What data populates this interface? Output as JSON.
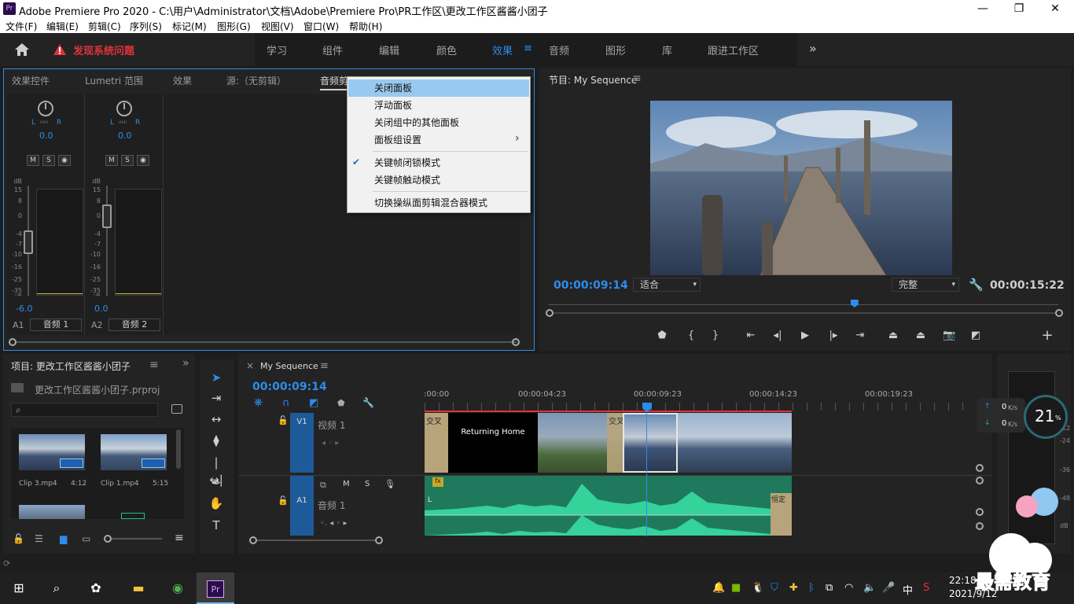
{
  "title_bar": {
    "app_icon": "Pr",
    "title": "Adobe Premiere Pro 2020 - C:\\用户\\Administrator\\文档\\Adobe\\Premiere Pro\\PR工作区\\更改工作区酱酱小团子",
    "minimize": "—",
    "maximize": "❐",
    "close": "✕"
  },
  "menu": [
    "文件(F)",
    "编辑(E)",
    "剪辑(C)",
    "序列(S)",
    "标记(M)",
    "图形(G)",
    "视图(V)",
    "窗口(W)",
    "帮助(H)"
  ],
  "workspace": {
    "home_icon": "home-icon",
    "alert_text": "发现系统问题",
    "tabs": [
      "学习",
      "组件",
      "编辑",
      "颜色",
      "效果",
      "音频",
      "图形",
      "库",
      "跟进工作区"
    ],
    "active": "效果",
    "more": "»"
  },
  "source_panel": {
    "tabs": [
      "效果控件",
      "Lumetri 范围",
      "效果",
      "源:（无剪辑）",
      "音频剪辑混合器"
    ],
    "active_tab": "音频剪辑混合器"
  },
  "mixer": {
    "channels": [
      {
        "id": "A1",
        "name": "音频 1",
        "pan": "0.0",
        "level": "-6.0",
        "L": "L",
        "R": "R"
      },
      {
        "id": "A2",
        "name": "音频 2",
        "pan": "0.0",
        "level": "0.0",
        "L": "L",
        "R": "R"
      }
    ],
    "btn_m": "M",
    "btn_s": "S",
    "btn_r": "◉",
    "db_scale": [
      "dB",
      "15",
      "8",
      "0",
      "-4",
      "-7",
      "-10",
      "-16",
      "-25",
      "-35",
      "-∞"
    ]
  },
  "context_menu": {
    "items": [
      "关闭面板",
      "浮动面板",
      "关闭组中的其他面板",
      "面板组设置",
      "关键帧闭锁模式",
      "关键帧触动模式",
      "切换操纵面剪辑混合器模式"
    ],
    "submenu_arrow": "›",
    "check": "✔"
  },
  "program": {
    "title": "节目: My Sequence",
    "menu_icon": "≡",
    "timecode": "00:00:09:14",
    "fit": "适合",
    "quality": "完整",
    "duration": "00:00:15:22",
    "playhead_fraction": 0.6
  },
  "project": {
    "title": "项目: 更改工作区酱酱小团子",
    "project_file": "更改工作区酱酱小团子.prproj",
    "search_placeholder": "",
    "clips": [
      {
        "name": "Clip 3.mp4",
        "duration": "4:12"
      },
      {
        "name": "Clip 1.mp4",
        "duration": "5:15"
      }
    ],
    "more": "»"
  },
  "timeline": {
    "tab": "My Sequence",
    "close": "×",
    "timecode": "00:00:09:14",
    "ruler": [
      ":00:00",
      "00:00:04:23",
      "00:00:09:23",
      "00:00:14:23",
      "00:00:19:23"
    ],
    "v1": {
      "id": "V1",
      "name": "视频 1",
      "clips": [
        {
          "label": "交叉",
          "type": "transition"
        },
        {
          "label": "Returning Home",
          "type": "title"
        },
        {
          "label": "交叉溶",
          "type": "transition"
        }
      ]
    },
    "a1": {
      "id": "A1",
      "name": "音频 1",
      "m": "M",
      "s": "S",
      "fx": "fx",
      "constant": "恒定",
      "L": "L"
    }
  },
  "meter_overlay": {
    "up": "0",
    "down": "0",
    "unit": "K/s",
    "percent": "21",
    "pct": "%"
  },
  "right_meter_scale": [
    "-12",
    "-24",
    "-36",
    "-48",
    "dB"
  ],
  "taskbar": {
    "time": "22:18",
    "date": "2021/9/12",
    "ime": "中",
    "watermark": "最需教育"
  }
}
